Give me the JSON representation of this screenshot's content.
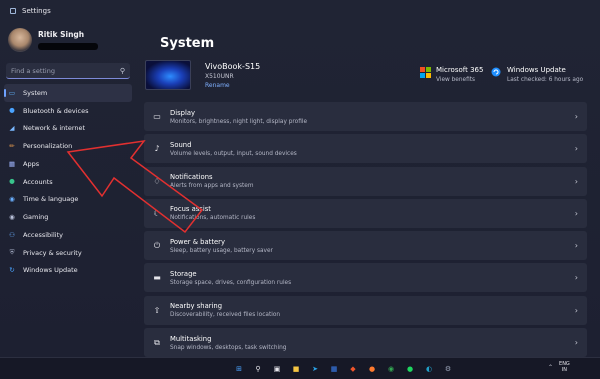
{
  "window": {
    "title": "Settings"
  },
  "profile": {
    "name": "Ritik Singh"
  },
  "search": {
    "placeholder": "Find a setting"
  },
  "sidebar": {
    "items": [
      {
        "label": "System",
        "icon": "system-icon",
        "color": "#5fb4ff",
        "active": true
      },
      {
        "label": "Bluetooth & devices",
        "icon": "bluetooth-icon",
        "color": "#4aa3ff"
      },
      {
        "label": "Network & internet",
        "icon": "network-icon",
        "color": "#7ab8ff"
      },
      {
        "label": "Personalization",
        "icon": "brush-icon",
        "color": "#f0a050"
      },
      {
        "label": "Apps",
        "icon": "apps-icon",
        "color": "#a0b6ff"
      },
      {
        "label": "Accounts",
        "icon": "accounts-icon",
        "color": "#39c48c"
      },
      {
        "label": "Time & language",
        "icon": "globe-icon",
        "color": "#6ab0ff"
      },
      {
        "label": "Gaming",
        "icon": "gaming-icon",
        "color": "#b8c0d8"
      },
      {
        "label": "Accessibility",
        "icon": "accessibility-icon",
        "color": "#6ab0ff"
      },
      {
        "label": "Privacy & security",
        "icon": "shield-icon",
        "color": "#a8b0c8"
      },
      {
        "label": "Windows Update",
        "icon": "update-icon",
        "color": "#4aa3ff"
      }
    ]
  },
  "main": {
    "title": "System",
    "device": {
      "name": "VivoBook-S15",
      "model": "X510UNR",
      "rename_label": "Rename"
    },
    "tiles": [
      {
        "title": "Microsoft 365",
        "subtitle": "View benefits",
        "icon": "microsoft-icon"
      },
      {
        "title": "Windows Update",
        "subtitle": "Last checked: 6 hours ago",
        "icon": "update-icon"
      }
    ],
    "cards": [
      {
        "title": "Display",
        "subtitle": "Monitors, brightness, night light, display profile",
        "icon": "display-icon"
      },
      {
        "title": "Sound",
        "subtitle": "Volume levels, output, input, sound devices",
        "icon": "sound-icon"
      },
      {
        "title": "Notifications",
        "subtitle": "Alerts from apps and system",
        "icon": "bell-icon"
      },
      {
        "title": "Focus assist",
        "subtitle": "Notifications, automatic rules",
        "icon": "moon-icon"
      },
      {
        "title": "Power & battery",
        "subtitle": "Sleep, battery usage, battery saver",
        "icon": "power-icon"
      },
      {
        "title": "Storage",
        "subtitle": "Storage space, drives, configuration rules",
        "icon": "storage-icon"
      },
      {
        "title": "Nearby sharing",
        "subtitle": "Discoverability, received files location",
        "icon": "share-icon"
      },
      {
        "title": "Multitasking",
        "subtitle": "Snap windows, desktops, task switching",
        "icon": "multitask-icon"
      }
    ]
  },
  "taskbar": {
    "apps": [
      {
        "name": "start-icon",
        "color": "#4aa3ff"
      },
      {
        "name": "search-icon",
        "color": "#e6e6ec"
      },
      {
        "name": "task-view-icon",
        "color": "#e6e6ec"
      },
      {
        "name": "explorer-icon",
        "color": "#f5c542"
      },
      {
        "name": "telegram-icon",
        "color": "#2aa3e8"
      },
      {
        "name": "store-icon",
        "color": "#3b82f6"
      },
      {
        "name": "brave-icon",
        "color": "#f0552b"
      },
      {
        "name": "firefox-icon",
        "color": "#ff7a2e"
      },
      {
        "name": "chrome-icon",
        "color": "#34a853"
      },
      {
        "name": "spotify-icon",
        "color": "#1ed760"
      },
      {
        "name": "edge-icon",
        "color": "#22a0c8"
      },
      {
        "name": "settings-icon",
        "color": "#9aa3b8"
      }
    ],
    "lang_line1": "ENG",
    "lang_line2": "IN"
  },
  "accent_color": "#6ea2ff",
  "annotation_color": "#e23030"
}
